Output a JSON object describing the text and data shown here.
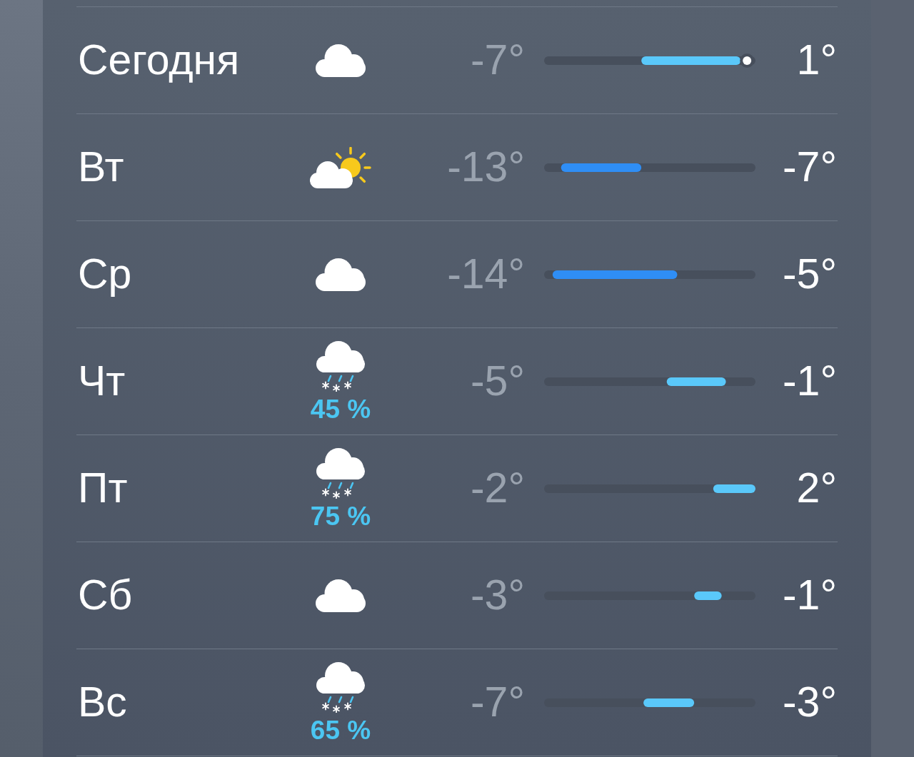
{
  "forecast": {
    "days": [
      {
        "day": "Сегодня",
        "kind": "cloud",
        "low": "-7°",
        "high": "1°"
      },
      {
        "day": "Вт",
        "kind": "partly-sunny",
        "low": "-13°",
        "high": "-7°"
      },
      {
        "day": "Ср",
        "kind": "cloud",
        "low": "-14°",
        "high": "-5°"
      },
      {
        "day": "Чт",
        "kind": "sleet",
        "precipitation": "45 %",
        "low": "-5°",
        "high": "-1°"
      },
      {
        "day": "Пт",
        "kind": "sleet",
        "precipitation": "75 %",
        "low": "-2°",
        "high": "2°"
      },
      {
        "day": "Сб",
        "kind": "cloud",
        "low": "-3°",
        "high": "-1°"
      },
      {
        "day": "Вс",
        "kind": "sleet",
        "precipitation": "65 %",
        "low": "-7°",
        "high": "-3°"
      }
    ]
  }
}
